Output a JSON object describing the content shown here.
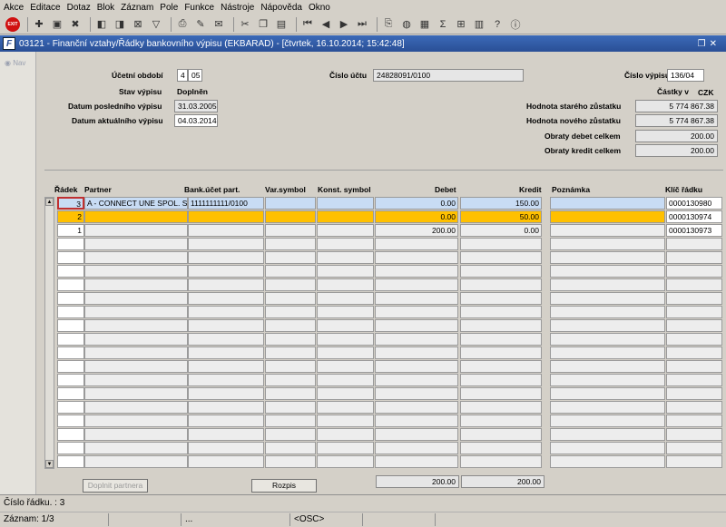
{
  "menu": [
    "Akce",
    "Editace",
    "Dotaz",
    "Blok",
    "Záznam",
    "Pole",
    "Funkce",
    "Nástroje",
    "Nápověda",
    "Okno"
  ],
  "window": {
    "title": "03121 - Finanční vztahy/Řádky bankovního výpisu (EKBARAD) - [čtvrtek, 16.10.2014; 15:42:48]",
    "app_icon": "F"
  },
  "nav": {
    "label": "Nav"
  },
  "header": {
    "ucetni_obdobi_label": "Účetní období",
    "ucetni_obdobi_a": "4",
    "ucetni_obdobi_b": "05",
    "stav_vypisu_label": "Stav výpisu",
    "stav_vypisu_value": "Doplněn",
    "datum_posledniho_label": "Datum posledního výpisu",
    "datum_posledniho_value": "31.03.2005",
    "datum_aktualniho_label": "Datum aktuálního výpisu",
    "datum_aktualniho_value": "04.03.2014",
    "cislo_uctu_label": "Číslo účtu",
    "cislo_uctu_value": "24828091/0100",
    "cislo_vypisu_label": "Číslo výpisu",
    "cislo_vypisu_value": "136/04",
    "castky_v_label": "Částky v",
    "mena": "CZK",
    "hodnota_stareho_label": "Hodnota starého zůstatku",
    "hodnota_stareho_value": "5 774 867.38",
    "hodnota_noveho_label": "Hodnota nového zůstatku",
    "hodnota_noveho_value": "5 774 867.38",
    "obraty_debet_label": "Obraty debet celkem",
    "obraty_debet_value": "200.00",
    "obraty_kredit_label": "Obraty kredit celkem",
    "obraty_kredit_value": "200.00"
  },
  "columns": {
    "radek": "Řádek",
    "partner": "Partner",
    "bank": "Bank.účet part.",
    "var": "Var.symbol",
    "konst": "Konst. symbol",
    "debet": "Debet",
    "kredit": "Kredit",
    "poznamka": "Poznámka",
    "klic": "Klíč řádku"
  },
  "rows": [
    {
      "radek": "3",
      "partner": "A - CONNECT UNE SPOL. S R",
      "bank": "1111111111/0100",
      "var": "",
      "konst": "",
      "debet": "0.00",
      "kredit": "150.00",
      "poznamka": "",
      "klic": "0000130980"
    },
    {
      "radek": "2",
      "partner": "",
      "bank": "",
      "var": "",
      "konst": "",
      "debet": "0.00",
      "kredit": "50.00",
      "poznamka": "",
      "klic": "0000130974"
    },
    {
      "radek": "1",
      "partner": "",
      "bank": "",
      "var": "",
      "konst": "",
      "debet": "200.00",
      "kredit": "0.00",
      "poznamka": "",
      "klic": "0000130973"
    }
  ],
  "totals": {
    "debet": "200.00",
    "kredit": "200.00"
  },
  "buttons": {
    "doplnit": "Doplnit partnera",
    "rozpis": "Rozpis"
  },
  "status": {
    "line1": "Číslo řádku. : 3",
    "zaznam": "Záznam: 1/3",
    "dots": "...",
    "osc": "<OSC>"
  }
}
